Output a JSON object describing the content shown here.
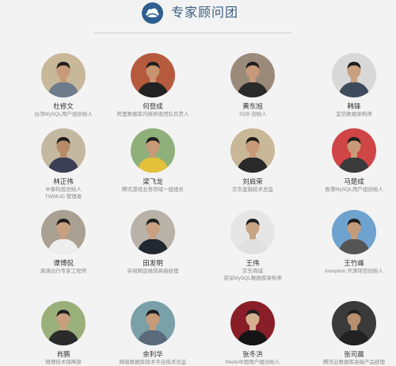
{
  "header": {
    "title": "专家顾问团"
  },
  "experts": [
    {
      "name": "杜修文",
      "roles": [
        "台湾MySQL用户组创始人"
      ],
      "bg": "#c8b89a",
      "skin": "#c79a78",
      "shirt": "#6c7a8a"
    },
    {
      "name": "何登成",
      "roles": [
        "阿里数据库内核研发团队负责人"
      ],
      "bg": "#b65a3e",
      "skin": "#c9936e",
      "shirt": "#222222"
    },
    {
      "name": "黄东旭",
      "roles": [
        "TiDB 创始人"
      ],
      "bg": "#9a8a7a",
      "skin": "#c89a7a",
      "shirt": "#2a2a2a"
    },
    {
      "name": "韩锋",
      "roles": [
        "宜信数据架构师"
      ],
      "bg": "#d8d8d8",
      "skin": "#c9a080",
      "shirt": "#3d4b5c"
    },
    {
      "name": "林正伟",
      "roles": [
        "中泰科技创始人",
        "TWMUG 管理者"
      ],
      "bg": "#c4b8a0",
      "skin": "#b88a68",
      "shirt": "#3a3f55"
    },
    {
      "name": "梁飞龙",
      "roles": [
        "腾讯游戏业务存储一组组长"
      ],
      "bg": "#8fb07a",
      "skin": "#c79a78",
      "shirt": "#e3c23a"
    },
    {
      "name": "刘启荣",
      "roles": [
        "京东金融技术总监"
      ],
      "bg": "#c9b898",
      "skin": "#c99a78",
      "shirt": "#2a2a2a"
    },
    {
      "name": "马楚成",
      "roles": [
        "香港MySQL用户组创始人"
      ],
      "bg": "#d04545",
      "skin": "#c99a78",
      "shirt": "#3a3a3a"
    },
    {
      "name": "谭博侃",
      "roles": [
        "滴滴出行专家工程师"
      ],
      "bg": "#a8a090",
      "skin": "#c8a080",
      "shirt": "#eeeeee"
    },
    {
      "name": "田发明",
      "roles": [
        "央视网运维部高级经理"
      ],
      "bg": "#b8b2a8",
      "skin": "#c9a080",
      "shirt": "#222831"
    },
    {
      "name": "王伟",
      "roles": [
        "京东商城",
        "资深MySQL数据库架构师"
      ],
      "bg": "#e6e6e6",
      "skin": "#c9a584",
      "shirt": "#e0e0e0"
    },
    {
      "name": "王竹峰",
      "roles": [
        "Inception 开源项目创始人"
      ],
      "bg": "#6fa3cf",
      "skin": "#c49a78",
      "shirt": "#555555"
    },
    {
      "name": "肖鹏",
      "roles": [
        "微博技术保障部"
      ],
      "bg": "#9ab07a",
      "skin": "#c8a080",
      "shirt": "#2a2a2a"
    },
    {
      "name": "余利华",
      "roles": [
        "网易数据库技术平台技术总监"
      ],
      "bg": "#7aa0a8",
      "skin": "#c79a78",
      "shirt": "#5a6a7a"
    },
    {
      "name": "张冬洪",
      "roles": [
        "Redis中国用户组创始人"
      ],
      "bg": "#8a1e28",
      "skin": "#d4b090",
      "shirt": "#151515"
    },
    {
      "name": "张司晨",
      "roles": [
        "腾讯云数据库高级产品经理"
      ],
      "bg": "#3a3a3a",
      "skin": "#b89070",
      "shirt": "#222222"
    }
  ]
}
